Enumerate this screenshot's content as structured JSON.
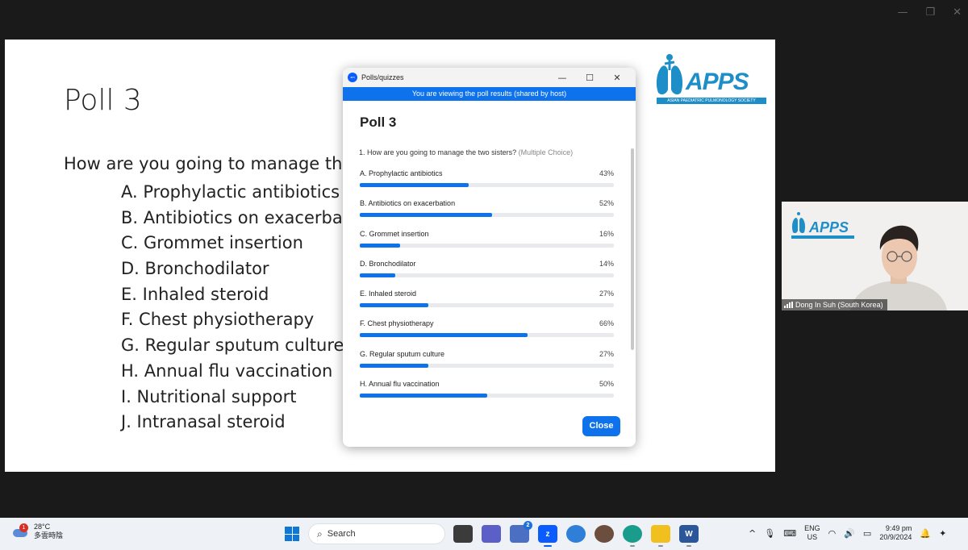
{
  "window_controls": {
    "minimize": "—",
    "restore": "❐",
    "close": "✕"
  },
  "slide": {
    "title": "Poll 3",
    "question": "How are you going to manage the",
    "options": [
      "A. Prophylactic antibiotics",
      "B. Antibiotics on exacerbat",
      "C. Grommet insertion",
      "D. Bronchodilator",
      "E. Inhaled steroid",
      "F. Chest physiotherapy",
      "G. Regular sputum culture",
      "H. Annual flu vaccination",
      "I. Nutritional support",
      "J. Intranasal steroid"
    ],
    "logo_text": "APPS",
    "logo_subtitle": "ASIAN PAEDIATRIC PULMONOLOGY SOCIETY"
  },
  "poll": {
    "window_title": "Polls/quizzes",
    "app_badge": "zm",
    "banner": "You are viewing the poll results (shared by host)",
    "heading": "Poll 3",
    "question": "1. How are you going to manage the two sisters?",
    "question_type": "(Multiple Choice)",
    "options": [
      {
        "label": "A. Prophylactic antibiotics",
        "pct": "43%",
        "value": 0.43
      },
      {
        "label": "B. Antibiotics on exacerbation",
        "pct": "52%",
        "value": 0.52
      },
      {
        "label": "C. Grommet insertion",
        "pct": "16%",
        "value": 0.16
      },
      {
        "label": "D. Bronchodilator",
        "pct": "14%",
        "value": 0.14
      },
      {
        "label": "E. Inhaled steroid",
        "pct": "27%",
        "value": 0.27
      },
      {
        "label": "F. Chest physiotherapy",
        "pct": "66%",
        "value": 0.66
      },
      {
        "label": "G. Regular sputum culture",
        "pct": "27%",
        "value": 0.27
      },
      {
        "label": "H. Annual flu vaccination",
        "pct": "50%",
        "value": 0.5
      }
    ],
    "close_label": "Close",
    "accent": "#0e72ed"
  },
  "video": {
    "participant_name": "Dong In Suh (South Korea)",
    "logo_text": "APPS"
  },
  "taskbar": {
    "weather_temp": "28°C",
    "weather_desc": "多雲時陰",
    "weather_badge": "1",
    "search_placeholder": "Search",
    "lang_top": "ENG",
    "lang_bottom": "US",
    "time": "9:49 pm",
    "date": "20/9/2024",
    "teams_badge": "2"
  }
}
